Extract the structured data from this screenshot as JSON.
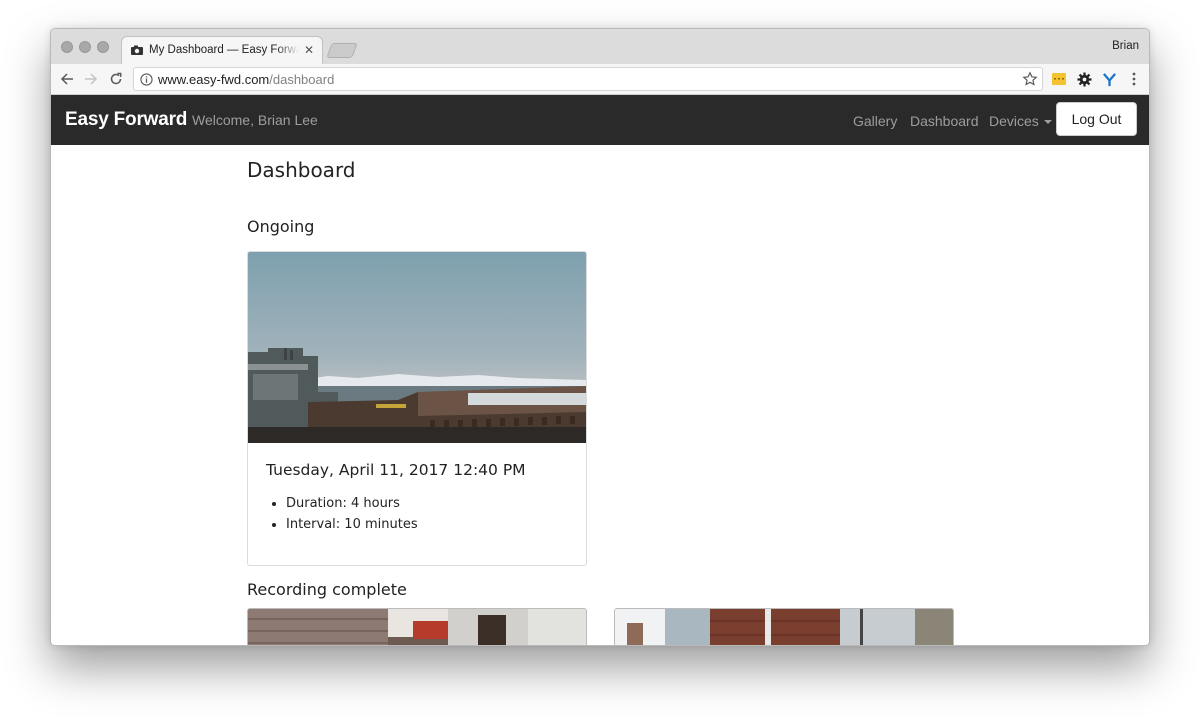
{
  "browser": {
    "tab_title": "My Dashboard — Easy Forward",
    "profile_name": "Brian",
    "url_host": "www.easy-fwd.com",
    "url_path": "/dashboard"
  },
  "navbar": {
    "brand": "Easy Forward",
    "welcome": "Welcome, Brian Lee",
    "links": [
      "Gallery",
      "Dashboard",
      "Devices"
    ],
    "logout_label": "Log Out"
  },
  "main": {
    "title": "Dashboard",
    "ongoing_heading": "Ongoing",
    "ongoing_card": {
      "date": "Tuesday, April 11, 2017 12:40 PM",
      "details": [
        "Duration: 4 hours",
        "Interval: 10 minutes"
      ]
    },
    "complete_heading": "Recording complete"
  },
  "icons": {
    "back": "arrow-left-icon",
    "forward": "arrow-right-icon",
    "reload": "reload-icon",
    "info": "info-icon",
    "bookmark": "star-icon",
    "menu": "kebab-menu-icon"
  },
  "colors": {
    "navbar_bg": "#2a2a2a",
    "nav_text": "#9d9d9d",
    "brand_text": "#ffffff"
  }
}
